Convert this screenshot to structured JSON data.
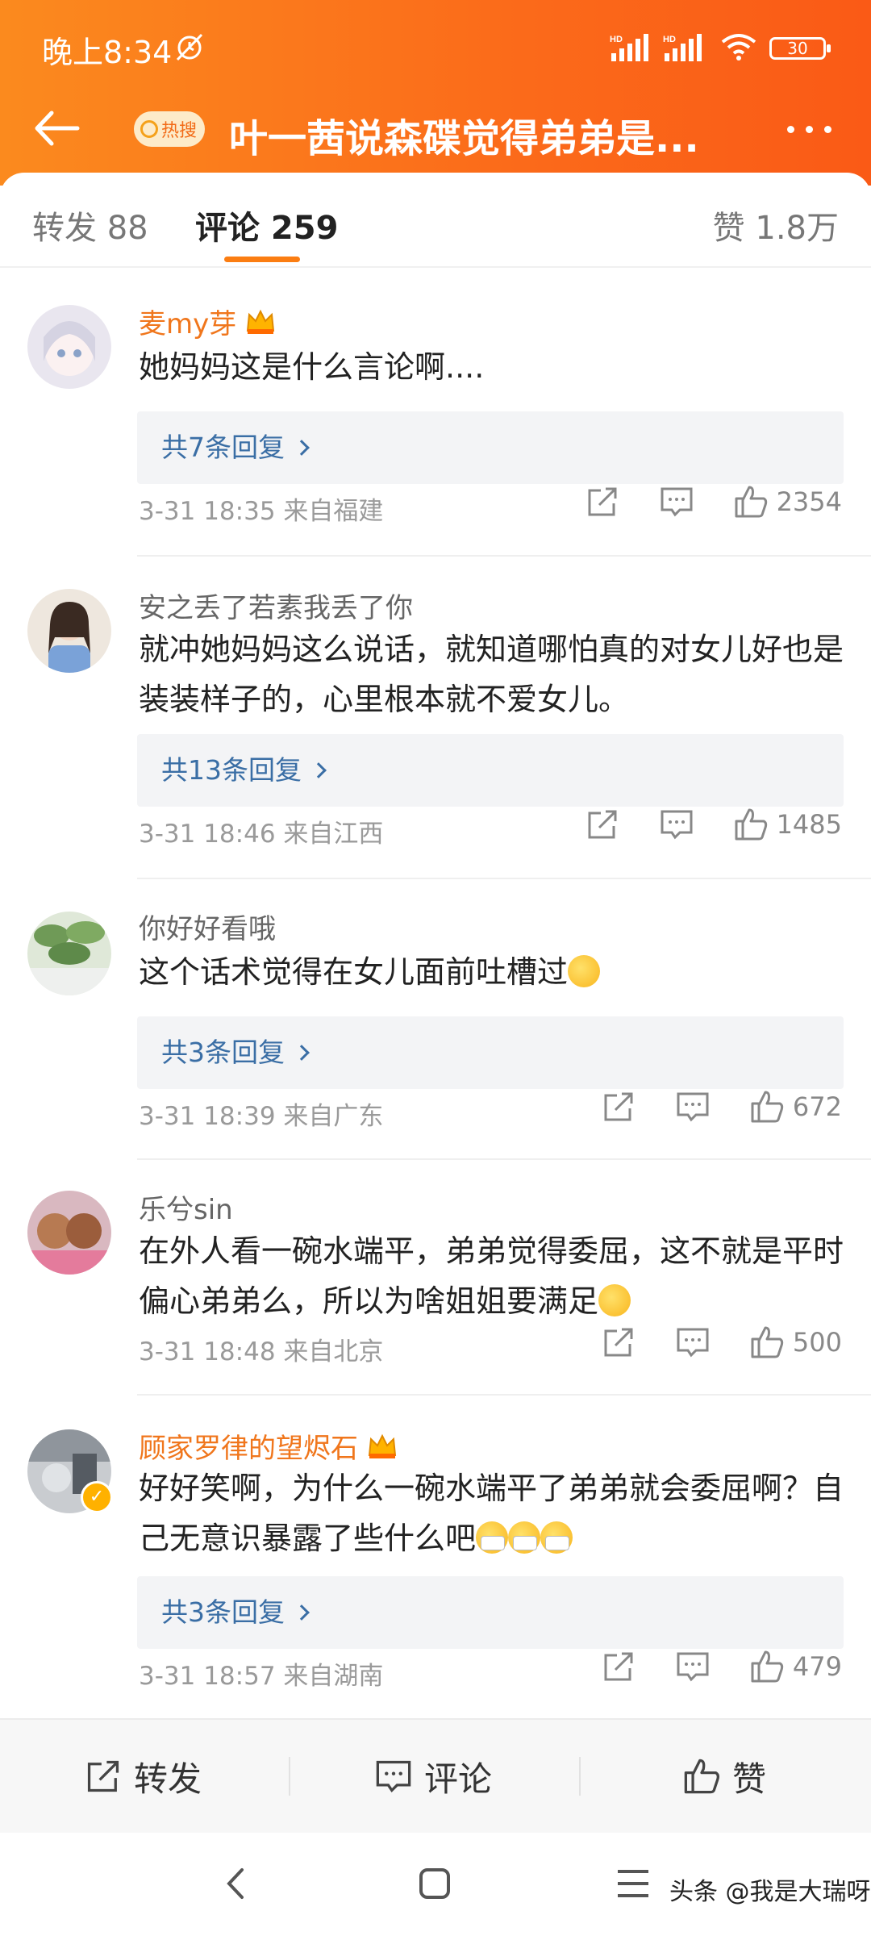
{
  "status_bar": {
    "time": "晚上8:34",
    "battery": "30"
  },
  "nav": {
    "hot_badge": "热搜",
    "title": "叶一茜说森碟觉得弟弟是..."
  },
  "tabs": {
    "repost": "转发 88",
    "comments": "评论 259",
    "likes": "赞 1.8万"
  },
  "comments": [
    {
      "user": "麦my芽",
      "vip": true,
      "text": "她妈妈这是什么言论啊....",
      "replies": "共7条回复",
      "meta": "3-31 18:35 来自福建",
      "likes": "2354"
    },
    {
      "user": "安之丢了若素我丢了你",
      "vip": false,
      "text": "就冲她妈妈这么说话，就知道哪怕真的对女儿好也是装装样子的，心里根本就不爱女儿。",
      "replies": "共13条回复",
      "meta": "3-31 18:46 来自江西",
      "likes": "1485"
    },
    {
      "user": "你好好看哦",
      "vip": false,
      "text": "这个话术觉得在女儿面前吐槽过",
      "replies": "共3条回复",
      "meta": "3-31 18:39 来自广东",
      "likes": "672"
    },
    {
      "user": "乐兮sin",
      "vip": false,
      "text": "在外人看一碗水端平，弟弟觉得委屈，这不就是平时偏心弟弟么，所以为啥姐姐要满足",
      "replies": "",
      "meta": "3-31 18:48 来自北京",
      "likes": "500"
    },
    {
      "user": "顾家罗律的望烬石",
      "vip": true,
      "text": "好好笑啊，为什么一碗水端平了弟弟就会委屈啊？自己无意识暴露了些什么吧",
      "replies": "共3条回复",
      "meta": "3-31 18:57 来自湖南",
      "likes": "479"
    }
  ],
  "bottom_bar": {
    "repost": "转发",
    "comment": "评论",
    "like": "赞"
  },
  "watermark": "头条 @我是大瑞呀",
  "colors": {
    "accent": "#fb7d12",
    "reply_link": "#3a6ea5",
    "vip_name": "#f0761c"
  }
}
